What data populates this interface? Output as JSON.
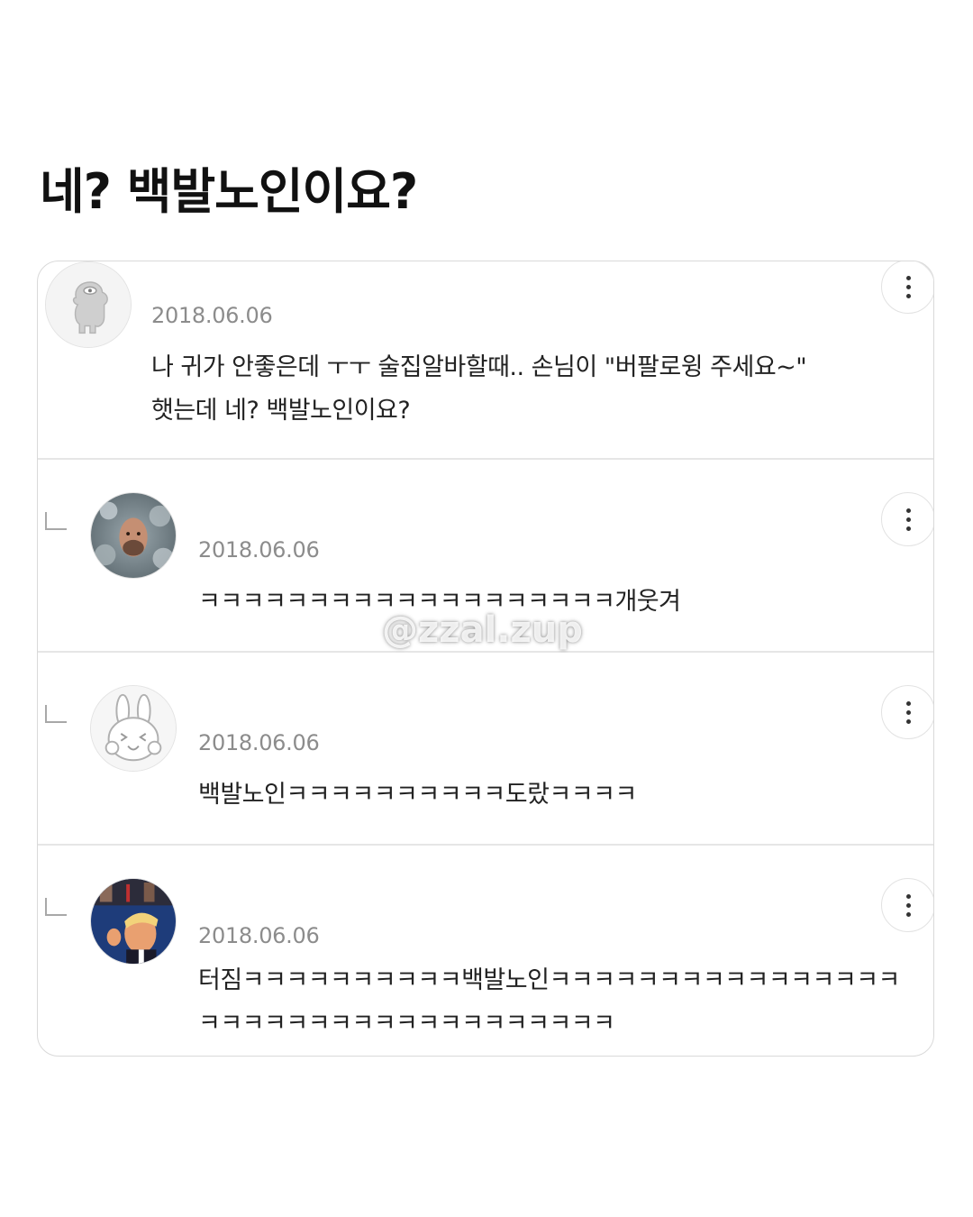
{
  "post": {
    "title": "네? 백발노인이요?"
  },
  "comments": [
    {
      "date": "2018.06.06",
      "text": "나 귀가 안좋은데 ㅜㅜ 술집알바할때.. 손님이 \"버팔로윙 주세요~\"\n햇는데 네? 백발노인이요?",
      "avatar_icon": "character-avatar",
      "is_reply": false
    },
    {
      "date": "2018.06.06",
      "text": "ㅋㅋㅋㅋㅋㅋㅋㅋㅋㅋㅋㅋㅋㅋㅋㅋㅋㅋㅋ개웃겨",
      "avatar_icon": "photo-avatar",
      "is_reply": true
    },
    {
      "date": "2018.06.06",
      "text": "백발노인ㅋㅋㅋㅋㅋㅋㅋㅋㅋㅋ도랐ㅋㅋㅋㅋ",
      "avatar_icon": "rabbit-avatar",
      "is_reply": true
    },
    {
      "date": "2018.06.06",
      "text": "터짐ㅋㅋㅋㅋㅋㅋㅋㅋㅋㅋ백발노인ㅋㅋㅋㅋㅋㅋㅋㅋㅋㅋㅋㅋㅋㅋㅋㅋ\nㅋㅋㅋㅋㅋㅋㅋㅋㅋㅋㅋㅋㅋㅋㅋㅋㅋㅋㅋ",
      "avatar_icon": "photo-avatar",
      "is_reply": true
    }
  ],
  "watermark": "@zzal.zup",
  "icons": {
    "more": "more-vertical-icon",
    "reply": "reply-arrow-icon"
  }
}
